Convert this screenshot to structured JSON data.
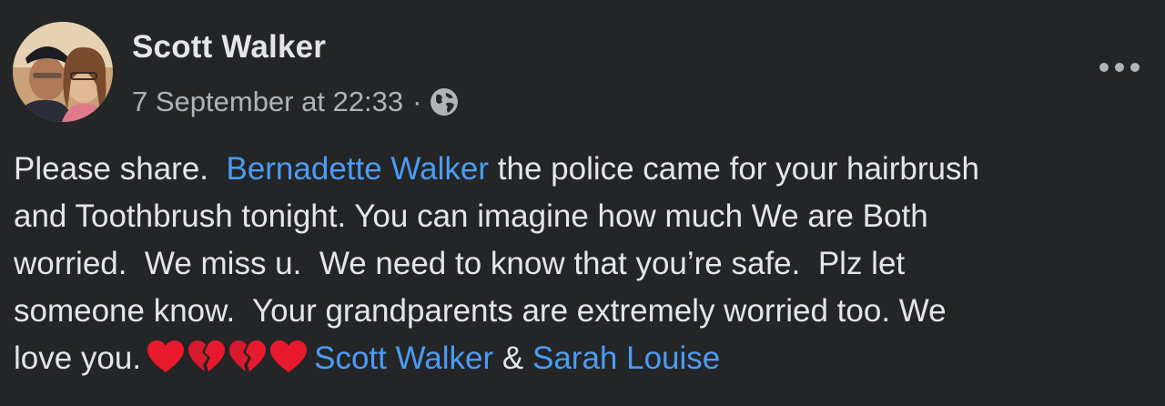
{
  "post": {
    "author": "Scott Walker",
    "timestamp": "7 September at 22:33",
    "separator": "·",
    "privacy_icon": "globe-icon",
    "more_icon": "more-options-icon",
    "text": {
      "line1_prefix": "Please share.  ",
      "mention1": "Bernadette Walker",
      "line1_suffix": " the police came for your hairbrush",
      "line2": "and Toothbrush tonight. You can imagine how much We are Both",
      "line3": "worried.  We miss u.  We need to know that you’re safe.  Plz let",
      "line4": "someone know.  Your grandparents are extremely worried too. We",
      "line5_prefix": "love you.",
      "emojis": [
        "red-heart",
        "broken-heart",
        "broken-heart",
        "red-heart"
      ],
      "mention2": "Scott Walker",
      "amp": " & ",
      "mention3": "Sarah Louise"
    }
  },
  "colors": {
    "background": "#242526",
    "text": "#e4e6eb",
    "secondary_text": "#b0b3b8",
    "mention": "#4b9cf5",
    "heart": "#e8192c"
  }
}
